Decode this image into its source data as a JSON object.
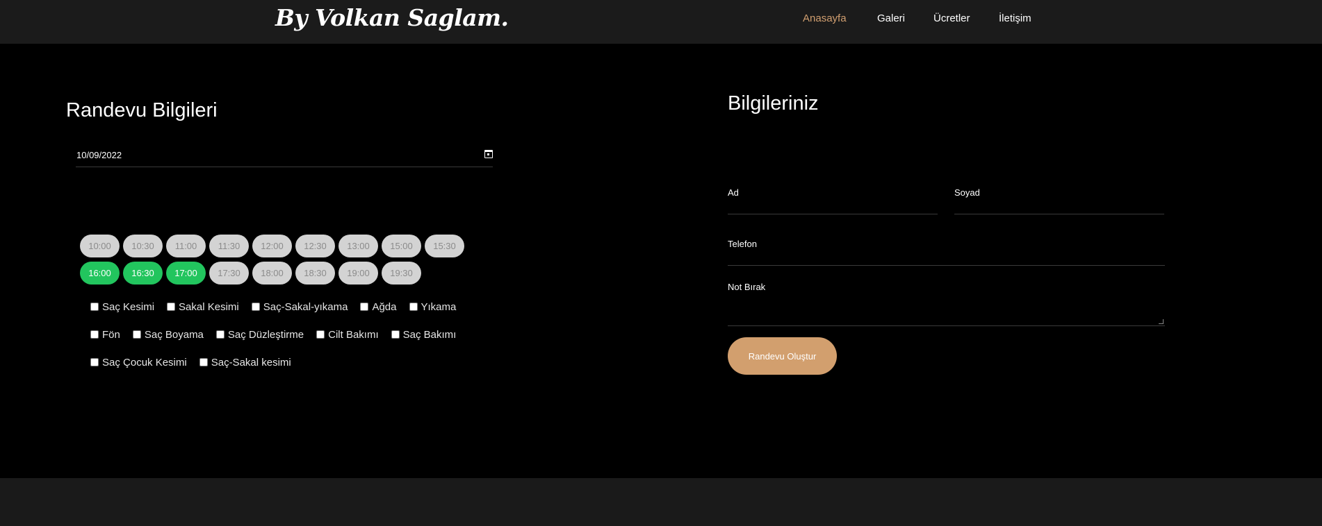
{
  "header": {
    "logo": "By Volkan Saglam.",
    "nav": [
      {
        "label": "Anasayfa",
        "active": true
      },
      {
        "label": "Galeri",
        "active": false
      },
      {
        "label": "Ücretler",
        "active": false
      },
      {
        "label": "İletişim",
        "active": false
      }
    ]
  },
  "appointment": {
    "title": "Randevu Bilgileri",
    "date_value": "10/09/2022",
    "slot_rows": [
      [
        {
          "time": "10:00",
          "available": false
        },
        {
          "time": "10:30",
          "available": false
        },
        {
          "time": "11:00",
          "available": false
        },
        {
          "time": "11:30",
          "available": false
        },
        {
          "time": "12:00",
          "available": false
        },
        {
          "time": "12:30",
          "available": false
        },
        {
          "time": "13:00",
          "available": false
        },
        {
          "time": "15:00",
          "available": false
        },
        {
          "time": "15:30",
          "available": false
        }
      ],
      [
        {
          "time": "16:00",
          "available": true
        },
        {
          "time": "16:30",
          "available": true
        },
        {
          "time": "17:00",
          "available": true
        },
        {
          "time": "17:30",
          "available": false
        },
        {
          "time": "18:00",
          "available": false
        },
        {
          "time": "18:30",
          "available": false
        },
        {
          "time": "19:00",
          "available": false
        },
        {
          "time": "19:30",
          "available": false
        }
      ]
    ],
    "service_rows": [
      [
        "Saç Kesimi",
        "Sakal Kesimi",
        "Saç-Sakal-yıkama",
        "Ağda",
        "Yıkama"
      ],
      [
        "Fön",
        "Saç Boyama",
        "Saç Düzleştirme",
        "Cilt Bakımı",
        "Saç Bakımı"
      ],
      [
        "Saç Çocuk Kesimi",
        "Saç-Sakal kesimi"
      ]
    ]
  },
  "form": {
    "title": "Bilgileriniz",
    "first_name_label": "Ad",
    "last_name_label": "Soyad",
    "phone_label": "Telefon",
    "note_label": "Not Bırak",
    "submit_label": "Randevu Oluştur"
  },
  "colors": {
    "accent": "#d19f70",
    "slot_available": "#22c55e",
    "slot_unavailable": "#d3d3d3",
    "button": "#d29f6e"
  }
}
